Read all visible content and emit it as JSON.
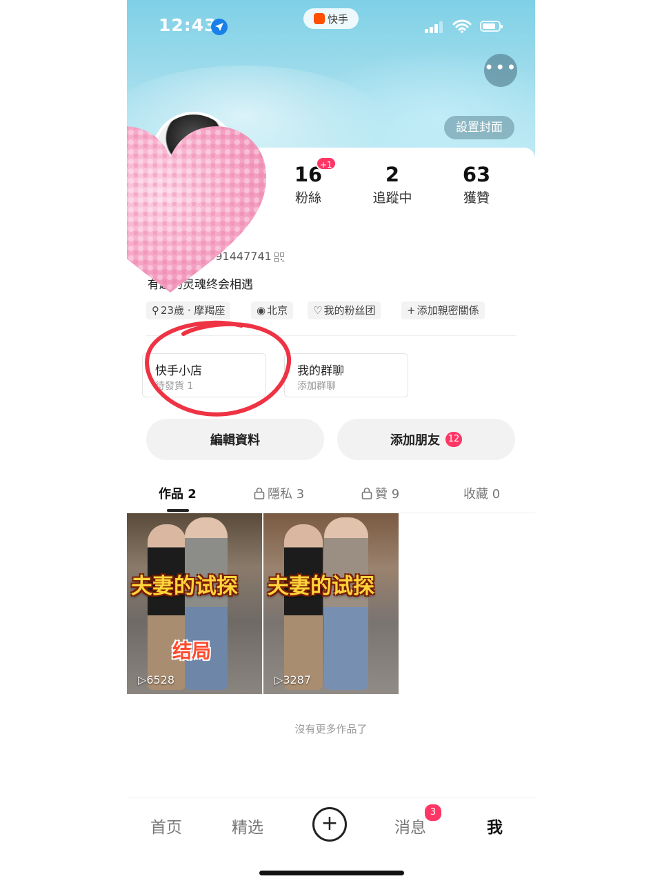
{
  "status_bar": {
    "time": "12:43",
    "app_name": "快手"
  },
  "header": {
    "more_label": "•••",
    "set_cover_label": "設置封面"
  },
  "profile": {
    "stats": [
      {
        "value": "16",
        "label": "粉絲",
        "badge": "+1"
      },
      {
        "value": "2",
        "label": "追蹤中"
      },
      {
        "value": "63",
        "label": "獲贊"
      }
    ],
    "id_text": "2591447741",
    "bio": "有趣的灵魂终会相遇",
    "tags": [
      {
        "icon": "search-icon",
        "label": "23歲 · 摩羯座"
      },
      {
        "icon": "location-icon",
        "label": "北京"
      },
      {
        "icon": "fan-group-icon",
        "label": "我的粉丝团"
      },
      {
        "icon": "plus-icon",
        "label": "添加親密關係"
      }
    ]
  },
  "entries": [
    {
      "title": "快手小店",
      "subtitle": "待發貨 1"
    },
    {
      "title": "我的群聊",
      "subtitle": "添加群聊"
    }
  ],
  "actions": {
    "edit_profile": "編輯資料",
    "add_friend": "添加朋友",
    "add_friend_badge": "12"
  },
  "tabs": [
    {
      "label": "作品",
      "count": "2"
    },
    {
      "label": "隱私",
      "count": "3"
    },
    {
      "label": "贊",
      "count": "9"
    },
    {
      "label": "收藏",
      "count": "0"
    }
  ],
  "videos": [
    {
      "title": "夫妻的试探",
      "tag": "结局",
      "views": "6528"
    },
    {
      "title": "夫妻的试探",
      "views": "3287"
    }
  ],
  "no_more_text": "沒有更多作品了",
  "bottom_nav": {
    "home": "首页",
    "featured": "精选",
    "create": "+",
    "messages": "消息",
    "messages_badge": "3",
    "me": "我"
  },
  "colors": {
    "accent_red": "#fe3666",
    "cover_blue": "#9fdcec",
    "annotation_red": "#ee3344",
    "heart_pink": "#f7a9c8"
  }
}
